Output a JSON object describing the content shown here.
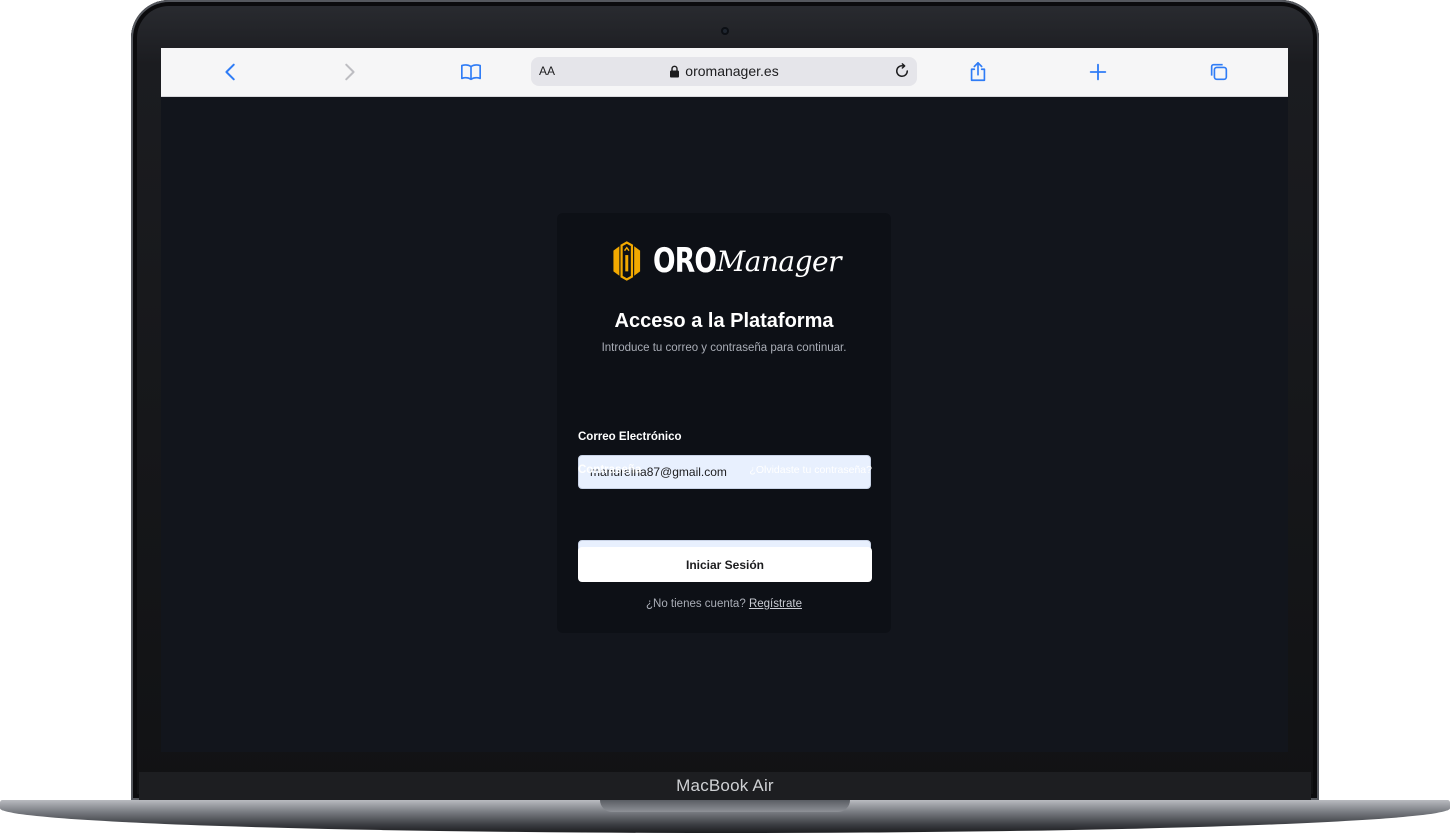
{
  "device": {
    "brand_label": "MacBook Air"
  },
  "browser": {
    "reader_label": "AA",
    "url": "oromanager.es",
    "icons": [
      "back-icon",
      "forward-icon",
      "bookmarks-icon",
      "lock-icon",
      "reload-icon",
      "share-icon",
      "new-tab-icon",
      "tabs-icon"
    ],
    "accent_color": "#2f7cf6"
  },
  "login": {
    "logo": {
      "wordmark_bold": "ORO",
      "wordmark_script": "Manager",
      "mark_color": "#f2a900"
    },
    "title": "Acceso a la Plataforma",
    "subtitle": "Introduce tu correo y contraseña para continuar.",
    "email": {
      "label": "Correo Electrónico",
      "value": "manureina87@gmail.com"
    },
    "password": {
      "label": "Contraseña",
      "value": "••••••••••",
      "forgot_label": "¿Olvidaste tu contraseña?"
    },
    "submit_label": "Iniciar Sesión",
    "register_prompt": "¿No tienes cuenta?",
    "register_link": "Regístrate"
  }
}
